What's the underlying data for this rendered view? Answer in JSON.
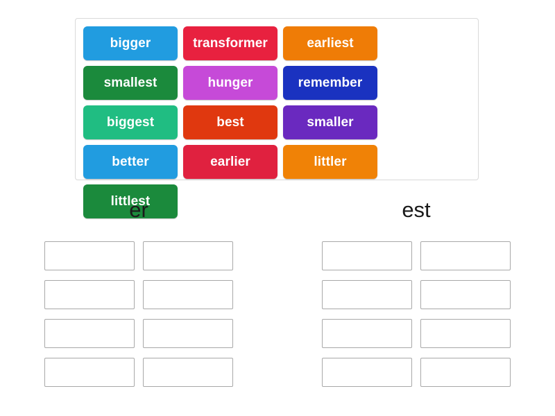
{
  "word_bank": {
    "name": "word-bank-panel",
    "tiles": [
      {
        "label": "bigger",
        "color": "#219ce0"
      },
      {
        "label": "transformer",
        "color": "#e8213f"
      },
      {
        "label": "earliest",
        "color": "#ef7c06"
      },
      {
        "label": "smallest",
        "color": "#1b8a3c"
      },
      {
        "label": "hunger",
        "color": "#c64ad8"
      },
      {
        "label": "remember",
        "color": "#1a32c0"
      },
      {
        "label": "biggest",
        "color": "#20bd82"
      },
      {
        "label": "best",
        "color": "#e0380f"
      },
      {
        "label": "smaller",
        "color": "#6a29bf"
      },
      {
        "label": "better",
        "color": "#219ce0"
      },
      {
        "label": "earlier",
        "color": "#e0213f"
      },
      {
        "label": "littler",
        "color": "#f08206"
      },
      {
        "label": "littlest",
        "color": "#1b8a3c"
      }
    ]
  },
  "sort_columns": [
    {
      "heading": "er",
      "dropzones": [
        "",
        "",
        "",
        "",
        "",
        "",
        "",
        ""
      ]
    },
    {
      "heading": "est",
      "dropzones": [
        "",
        "",
        "",
        "",
        "",
        "",
        "",
        ""
      ]
    }
  ]
}
